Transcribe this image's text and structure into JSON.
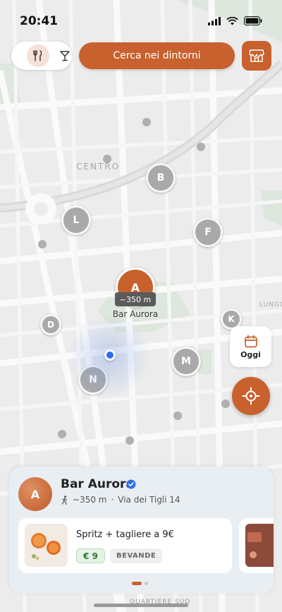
{
  "status": {
    "time": "20:41"
  },
  "controls": {
    "search_label": "Cerca nei dintorni",
    "today_label": "Oggi",
    "category_icons": [
      "fork-knife-icon",
      "cocktail-icon"
    ],
    "accent_color": "#c8612e"
  },
  "map": {
    "labels": {
      "center": "CENTRO",
      "lungo": "LUNGO",
      "south": "QUARTIERE SUD"
    },
    "markers": [
      {
        "letter": "B",
        "kind": "venue"
      },
      {
        "letter": "L",
        "kind": "venue"
      },
      {
        "letter": "F",
        "kind": "venue"
      },
      {
        "letter": "D",
        "kind": "venue"
      },
      {
        "letter": "K",
        "kind": "venue"
      },
      {
        "letter": "M",
        "kind": "venue"
      },
      {
        "letter": "N",
        "kind": "venue"
      }
    ],
    "selected": {
      "letter": "A",
      "distance": "~350 m",
      "name": "Bar Aurora"
    }
  },
  "sheet": {
    "avatar_letter": "A",
    "venue_name": "Bar Aurora",
    "distance": "~350 m",
    "separator": "·",
    "address": "Via dei Tigli 14",
    "offers": [
      {
        "title": "Spritz + tagliere a 9€",
        "price": "€ 9",
        "tag": "BEVANDE"
      }
    ]
  }
}
